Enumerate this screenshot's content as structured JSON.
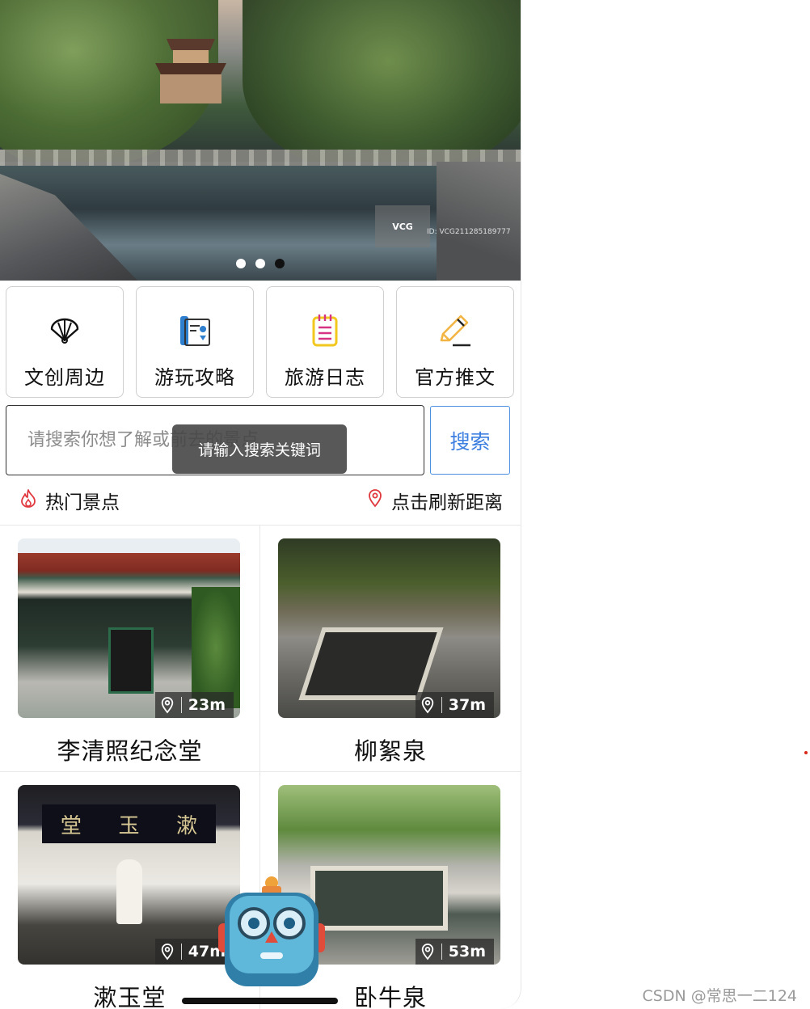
{
  "banner": {
    "watermark": "VCG",
    "watermark_id": "ID: VCG211285189777",
    "dots": 3,
    "active_dot": 3
  },
  "categories": [
    {
      "label": "文创周边",
      "icon": "fan-icon"
    },
    {
      "label": "游玩攻略",
      "icon": "guide-map-icon"
    },
    {
      "label": "旅游日志",
      "icon": "notepad-icon"
    },
    {
      "label": "官方推文",
      "icon": "pencil-edit-icon"
    }
  ],
  "search": {
    "placeholder": "请搜索你想了解或前去的景点",
    "button_label": "搜索",
    "toast": "请输入搜索关键词"
  },
  "hot": {
    "title": "热门景点",
    "refresh_label": "点击刷新距离"
  },
  "spots": [
    {
      "name": "李清照纪念堂",
      "distance": "23m"
    },
    {
      "name": "柳絮泉",
      "distance": "37m"
    },
    {
      "name": "漱玉堂",
      "distance": "47m"
    },
    {
      "name": "卧牛泉",
      "distance": "53m"
    }
  ],
  "plaque_text": [
    "堂",
    "玉",
    "漱"
  ],
  "credit": "CSDN @常思一二124",
  "colors": {
    "accent_blue": "#3d7fe0",
    "location_red": "#e0383e",
    "notepad_yellow": "#f2c81f",
    "notepad_pink": "#d63384"
  }
}
